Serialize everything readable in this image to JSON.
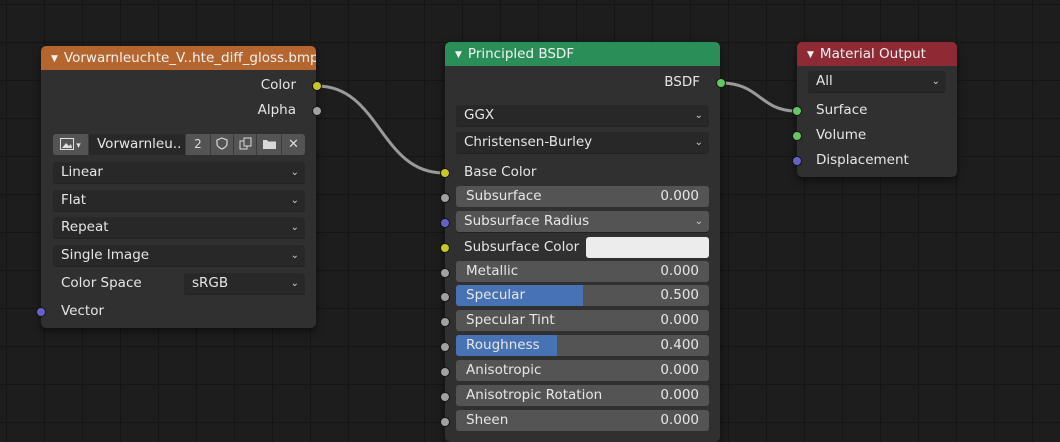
{
  "image_node": {
    "title": "Vorwarnleuchte_V..hte_diff_gloss.bmp",
    "header_color": "#b5662f",
    "outputs": [
      "Color",
      "Alpha"
    ],
    "image_name": "Vorwarnleu..",
    "users": "2",
    "interpolation": "Linear",
    "projection": "Flat",
    "extension": "Repeat",
    "source": "Single Image",
    "color_space_label": "Color Space",
    "color_space": "sRGB",
    "vector_label": "Vector"
  },
  "bsdf_node": {
    "title": "Principled BSDF",
    "header_color": "#2a8e58",
    "output": "BSDF",
    "distribution": "GGX",
    "subsurface_method": "Christensen-Burley",
    "base_color_label": "Base Color",
    "subsurface": {
      "label": "Subsurface",
      "value": "0.000",
      "fraction": 0.0
    },
    "subsurface_radius": "Subsurface Radius",
    "subsurface_color_label": "Subsurface Color",
    "subsurface_color": "#ececec",
    "metallic": {
      "label": "Metallic",
      "value": "0.000",
      "fraction": 0.0
    },
    "specular": {
      "label": "Specular",
      "value": "0.500",
      "fraction": 0.5
    },
    "specular_tint": {
      "label": "Specular Tint",
      "value": "0.000",
      "fraction": 0.0
    },
    "roughness": {
      "label": "Roughness",
      "value": "0.400",
      "fraction": 0.4
    },
    "anisotropic": {
      "label": "Anisotropic",
      "value": "0.000",
      "fraction": 0.0
    },
    "anisotropic_rotation": {
      "label": "Anisotropic Rotation",
      "value": "0.000",
      "fraction": 0.0
    },
    "sheen": {
      "label": "Sheen",
      "value": "0.000",
      "fraction": 0.0
    }
  },
  "output_node": {
    "title": "Material Output",
    "header_color": "#8e2a33",
    "target": "All",
    "inputs": [
      "Surface",
      "Volume",
      "Displacement"
    ]
  }
}
